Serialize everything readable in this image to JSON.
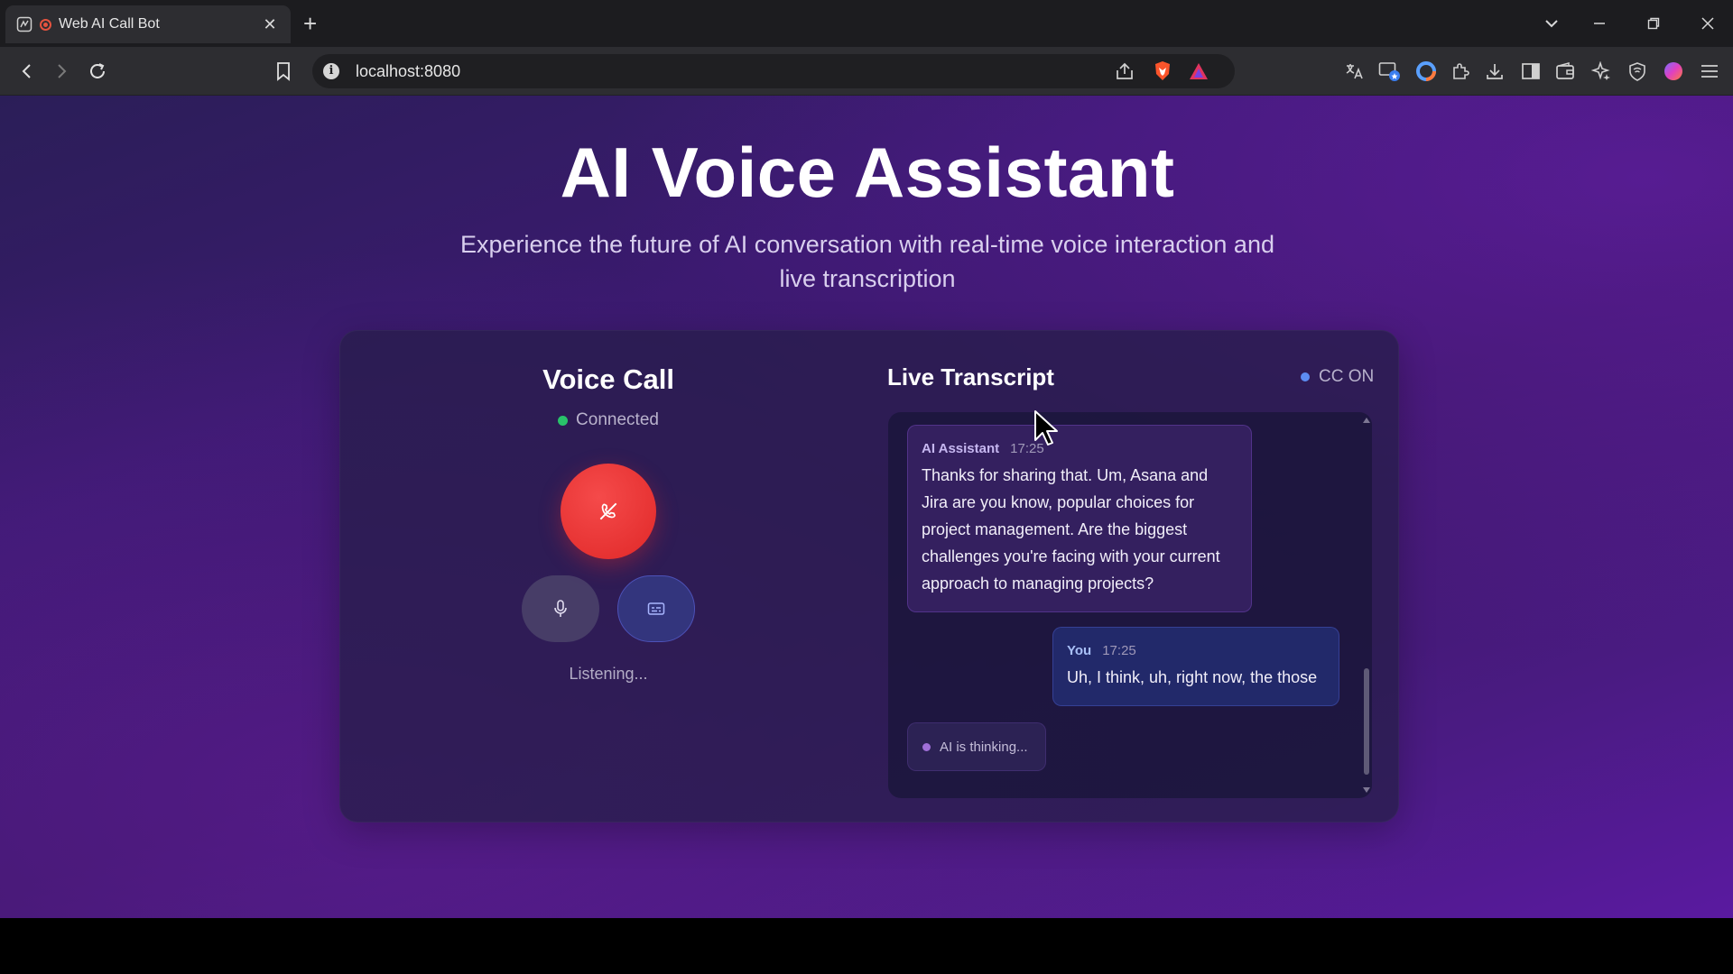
{
  "browser": {
    "tab_title": "Web AI Call Bot",
    "tab_close": "✕",
    "new_tab": "+",
    "url": "localhost:8080"
  },
  "hero": {
    "title": "AI Voice Assistant",
    "subtitle": "Experience the future of AI conversation with real-time voice interaction and live transcription"
  },
  "call": {
    "title": "Voice Call",
    "status": "Connected",
    "status_color": "#29c26a",
    "hangup_color": "#e83232",
    "listening": "Listening..."
  },
  "transcript": {
    "title": "Live Transcript",
    "cc_label": "CC ON",
    "messages": [
      {
        "sender": "AI Assistant",
        "time": "17:25",
        "text": "Thanks for sharing that. Um, Asana and Jira are you know, popular choices for project management. Are the biggest challenges you're facing with your current approach to managing projects?"
      },
      {
        "sender": "You",
        "time": "17:25",
        "text": "Uh, I think, uh, right now, the those"
      }
    ],
    "thinking": "AI is thinking..."
  }
}
